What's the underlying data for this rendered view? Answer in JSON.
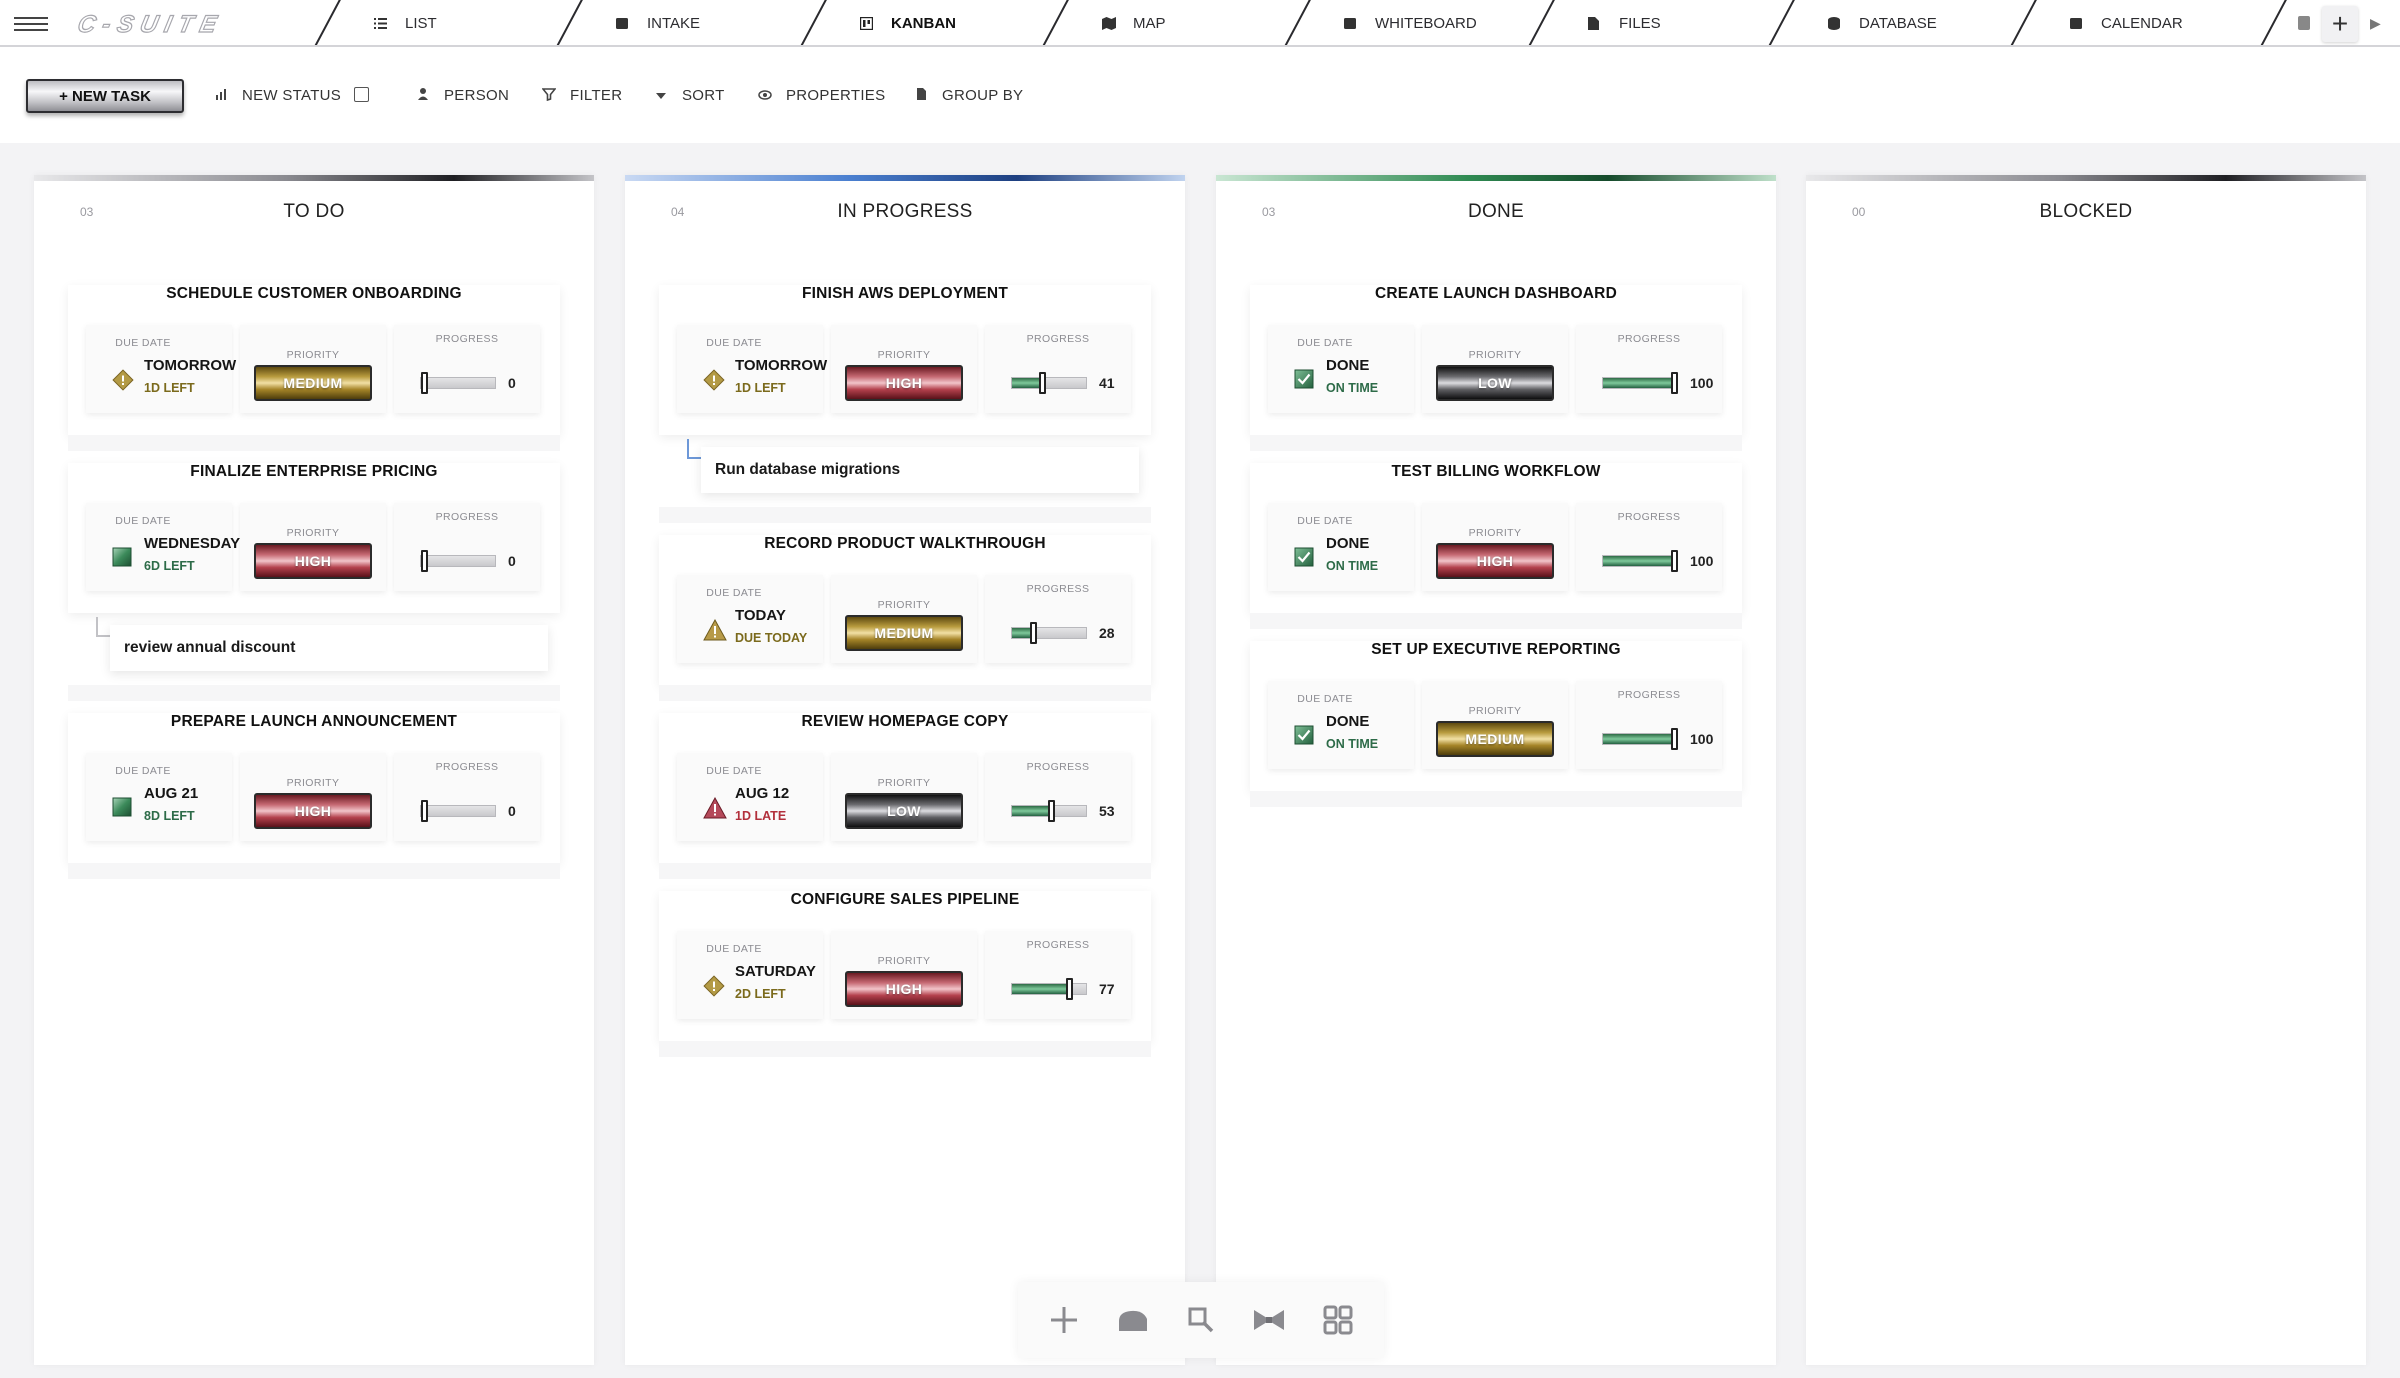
{
  "app": {
    "logo_text": "C-SUITE",
    "add_tab_label": "+",
    "scroll_right_label": "▶"
  },
  "tabs": [
    {
      "label": "LIST",
      "icon": "list-icon",
      "active": false
    },
    {
      "label": "INTAKE",
      "icon": "intake-icon",
      "active": false
    },
    {
      "label": "KANBAN",
      "icon": "kanban-icon",
      "active": true
    },
    {
      "label": "MAP",
      "icon": "map-icon",
      "active": false
    },
    {
      "label": "WHITEBOARD",
      "icon": "whiteboard-icon",
      "active": false
    },
    {
      "label": "FILES",
      "icon": "files-icon",
      "active": false
    },
    {
      "label": "DATABASE",
      "icon": "database-icon",
      "active": false
    },
    {
      "label": "CALENDAR",
      "icon": "calendar-icon",
      "active": false
    }
  ],
  "toolbar": {
    "new_task_label": "+ NEW TASK",
    "new_status_label": "NEW STATUS",
    "person_label": "PERSON",
    "filter_label": "FILTER",
    "sort_label": "SORT",
    "properties_label": "PROPERTIES",
    "group_by_label": "GROUP BY"
  },
  "labels": {
    "due_date": "DUE DATE",
    "priority": "PRIORITY",
    "progress": "PROGRESS"
  },
  "colors": {
    "high": "#a8343f",
    "medium": "#9b7d22",
    "low": "#2a2a2e",
    "green_text": "#2d6b48",
    "olive_text": "#7b6a1c",
    "late_text": "#b2303c",
    "todo_bar": "#2b2b2f",
    "inprogress_bar": "#4a7fd0",
    "done_bar": "#2f8a52",
    "blocked_bar": "#2b2b2f"
  },
  "columns": [
    {
      "count": "03",
      "title": "TO DO",
      "bar": "todo",
      "cards": [
        {
          "title": "SCHEDULE CUSTOMER ONBOARDING",
          "due_icon": "warning-diamond-icon",
          "due_main": "TOMORROW",
          "due_sub": "1D LEFT",
          "due_sub_color": "olive",
          "priority": "MEDIUM",
          "progress": 0,
          "progress_text": "0",
          "subtask": null
        },
        {
          "title": "FINALIZE ENTERPRISE PRICING",
          "due_icon": "calendar-square-icon",
          "due_main": "WEDNESDAY",
          "due_sub": "6D LEFT",
          "due_sub_color": "green",
          "priority": "HIGH",
          "progress": 0,
          "progress_text": "0",
          "subtask": "review annual discount"
        },
        {
          "title": "PREPARE LAUNCH ANNOUNCEMENT",
          "due_icon": "calendar-square-icon",
          "due_main": "AUG 21",
          "due_sub": "8D LEFT",
          "due_sub_color": "green",
          "priority": "HIGH",
          "progress": 0,
          "progress_text": "0",
          "subtask": null
        }
      ]
    },
    {
      "count": "04",
      "title": "IN PROGRESS",
      "bar": "inprogress",
      "cards": [
        {
          "title": "FINISH AWS DEPLOYMENT",
          "due_icon": "warning-diamond-icon",
          "due_main": "TOMORROW",
          "due_sub": "1D LEFT",
          "due_sub_color": "olive",
          "priority": "HIGH",
          "progress": 41,
          "progress_text": "41",
          "subtask": "Run database migrations"
        },
        {
          "title": "RECORD PRODUCT WALKTHROUGH",
          "due_icon": "warning-triangle-icon",
          "due_main": "TODAY",
          "due_sub": "DUE TODAY",
          "due_sub_color": "olive",
          "priority": "MEDIUM",
          "progress": 28,
          "progress_text": "28",
          "subtask": null
        },
        {
          "title": "REVIEW HOMEPAGE COPY",
          "due_icon": "late-triangle-icon",
          "due_main": "AUG 12",
          "due_sub": "1D LATE",
          "due_sub_color": "late",
          "priority": "LOW",
          "progress": 53,
          "progress_text": "53",
          "subtask": null
        },
        {
          "title": "CONFIGURE SALES PIPELINE",
          "due_icon": "warning-diamond-icon",
          "due_main": "SATURDAY",
          "due_sub": "2D LEFT",
          "due_sub_color": "olive",
          "priority": "HIGH",
          "progress": 77,
          "progress_text": "77",
          "subtask": null
        }
      ]
    },
    {
      "count": "03",
      "title": "DONE",
      "bar": "done",
      "cards": [
        {
          "title": "CREATE LAUNCH DASHBOARD",
          "due_icon": "checkbox-checked-icon",
          "due_main": "DONE",
          "due_sub": "ON TIME",
          "due_sub_color": "green",
          "priority": "LOW",
          "progress": 100,
          "progress_text": "100",
          "subtask": null
        },
        {
          "title": "TEST BILLING WORKFLOW",
          "due_icon": "checkbox-checked-icon",
          "due_main": "DONE",
          "due_sub": "ON TIME",
          "due_sub_color": "green",
          "priority": "HIGH",
          "progress": 100,
          "progress_text": "100",
          "subtask": null
        },
        {
          "title": "SET UP EXECUTIVE REPORTING",
          "due_icon": "checkbox-checked-icon",
          "due_main": "DONE",
          "due_sub": "ON TIME",
          "due_sub_color": "green",
          "priority": "MEDIUM",
          "progress": 100,
          "progress_text": "100",
          "subtask": null
        }
      ]
    },
    {
      "count": "00",
      "title": "BLOCKED",
      "bar": "blocked",
      "cards": []
    }
  ],
  "dock": [
    {
      "icon": "plus-icon"
    },
    {
      "icon": "cloud-icon"
    },
    {
      "icon": "search-icon"
    },
    {
      "icon": "bowtie-icon"
    },
    {
      "icon": "grid-icon"
    }
  ]
}
